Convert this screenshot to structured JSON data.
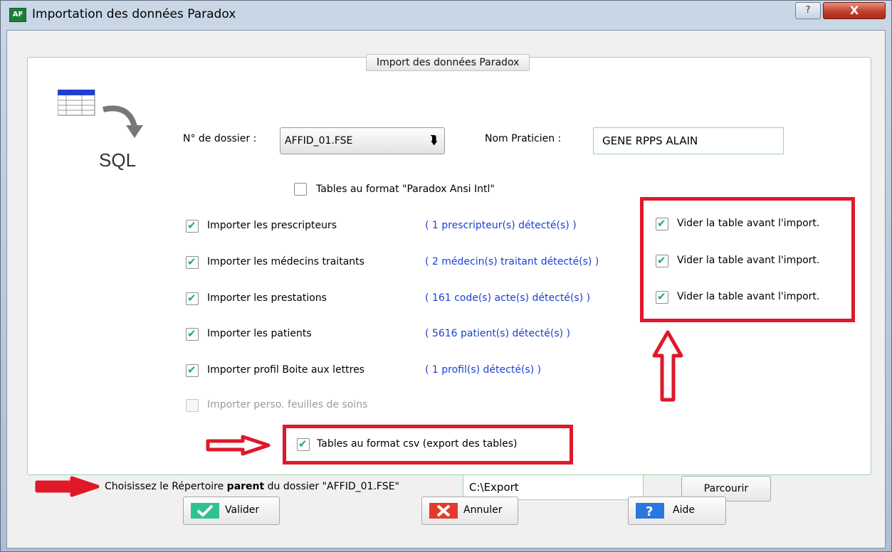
{
  "window": {
    "title": "Importation des données Paradox",
    "app_icon_label": "AF",
    "help_label": "?",
    "close_label": "X"
  },
  "group": {
    "title": "Import des données Paradox"
  },
  "logo": {
    "text": "SQL"
  },
  "dossier": {
    "label": "N° de dossier :",
    "value": "AFFID_01.FSE",
    "arrow": "⮯"
  },
  "praticien": {
    "label": "Nom Praticien :",
    "value": "GENE RPPS ALAIN"
  },
  "ansi": {
    "label": "Tables au format \"Paradox Ansi Intl\"",
    "checked": false
  },
  "imports": [
    {
      "label": "Importer les prescripteurs",
      "detected": "( 1 prescripteur(s) détecté(s) )",
      "checked": true
    },
    {
      "label": "Importer les médecins traitants",
      "detected": "( 2 médecin(s) traitant détecté(s) )",
      "checked": true
    },
    {
      "label": "Importer les prestations",
      "detected": "( 161 code(s) acte(s) détecté(s) )",
      "checked": true
    },
    {
      "label": "Importer les patients",
      "detected": "( 5616 patient(s) détecté(s) )",
      "checked": true
    },
    {
      "label": "Importer profil Boite aux lettres",
      "detected": "( 1 profil(s) détecté(s) )",
      "checked": true
    },
    {
      "label": "Importer perso. feuilles de soins",
      "detected": "",
      "checked": false
    }
  ],
  "vider": [
    {
      "label": "Vider la table avant l'import.",
      "checked": true
    },
    {
      "label": "Vider la table avant l'import.",
      "checked": true
    },
    {
      "label": "Vider la table avant l'import.",
      "checked": true
    }
  ],
  "csv": {
    "label": "Tables au format csv (export des tables)",
    "checked": true
  },
  "repertoire": {
    "label_pre": "Choisissez le Répertoire ",
    "label_bold": "parent",
    "label_post": " du dossier \"AFFID_01.FSE\"",
    "value": "C:\\Export",
    "browse_label": "Parcourir"
  },
  "buttons": {
    "ok": "Valider",
    "cancel": "Annuler",
    "help": "Aide"
  },
  "colors": {
    "highlight": "#e0182a",
    "detected_text": "#1b3fd4",
    "check": "#1aaa7e"
  }
}
